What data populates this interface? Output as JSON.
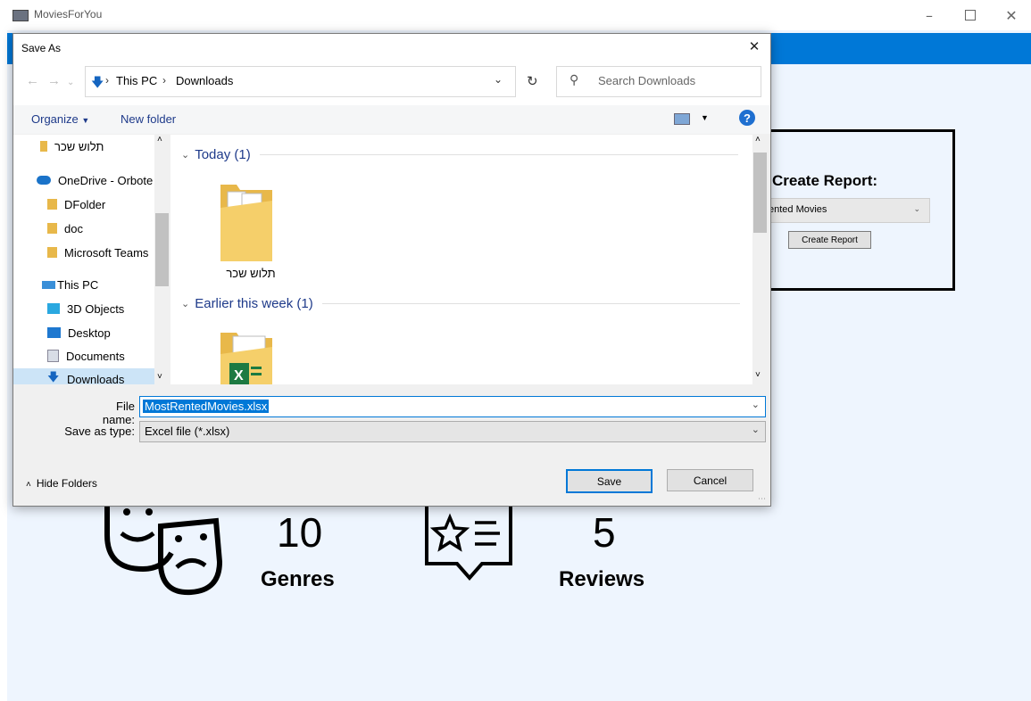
{
  "window": {
    "title": "MoviesForYou"
  },
  "report": {
    "label": "Create Report:",
    "selected": "ented Movies",
    "button": "Create Report"
  },
  "stats": [
    {
      "value": "10",
      "label": "Genres",
      "icon": "theater-masks-icon"
    },
    {
      "value": "5",
      "label": "Reviews",
      "icon": "star-review-icon"
    }
  ],
  "dialog": {
    "title": "Save As",
    "breadcrumb": [
      "This PC",
      "Downloads"
    ],
    "search_placeholder": "Search Downloads",
    "organize": "Organize",
    "new_folder": "New folder",
    "nav_items": [
      {
        "label": "תלוש שכר",
        "icon": "folder-icon"
      },
      {
        "label": "OneDrive - Orbote",
        "icon": "onedrive-icon"
      },
      {
        "label": "DFolder",
        "icon": "folder-icon"
      },
      {
        "label": "doc",
        "icon": "folder-icon"
      },
      {
        "label": "Microsoft Teams",
        "icon": "folder-icon"
      },
      {
        "label": "This PC",
        "icon": "computer-icon"
      },
      {
        "label": "3D Objects",
        "icon": "cube-icon"
      },
      {
        "label": "Desktop",
        "icon": "desktop-icon"
      },
      {
        "label": "Documents",
        "icon": "documents-icon"
      },
      {
        "label": "Downloads",
        "icon": "download-icon"
      }
    ],
    "groups": [
      {
        "title": "Today (1)",
        "items": [
          "תלוש שכר"
        ]
      },
      {
        "title": "Earlier this week (1)",
        "items": [
          ""
        ]
      }
    ],
    "file_name_label": "File name:",
    "file_name": "MostRentedMovies.xlsx",
    "save_type_label": "Save as type:",
    "save_type": "Excel file (*.xlsx)",
    "hide_folders": "Hide Folders",
    "save": "Save",
    "cancel": "Cancel"
  },
  "colors": {
    "accent": "#0078d7",
    "background": "#eef5fe",
    "group_header": "#1e3a8a",
    "selection": "#0078d7"
  }
}
